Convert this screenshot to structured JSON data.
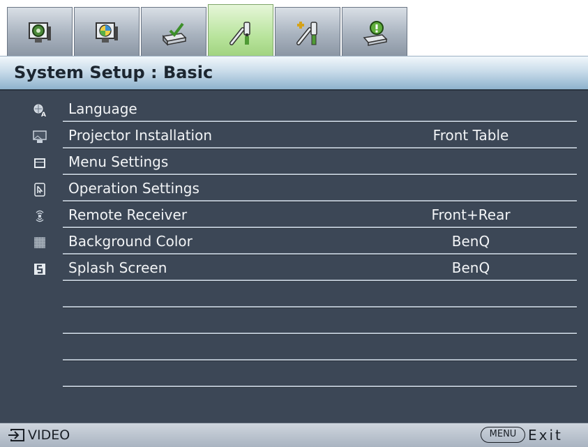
{
  "tabs": [
    {
      "name": "picture",
      "icon": "monitor-gear-icon"
    },
    {
      "name": "picture-advanced",
      "icon": "monitor-palette-icon"
    },
    {
      "name": "display",
      "icon": "projector-check-icon"
    },
    {
      "name": "system-setup-basic",
      "icon": "tools-icon",
      "active": true
    },
    {
      "name": "system-setup-advanced",
      "icon": "tools-plus-icon"
    },
    {
      "name": "information",
      "icon": "projector-info-icon"
    }
  ],
  "title": "System Setup : Basic",
  "menu": {
    "items": [
      {
        "label": "Language",
        "value": "",
        "icon": "globe-language-icon"
      },
      {
        "label": "Projector Installation",
        "value": "Front Table",
        "icon": "projector-installation-icon"
      },
      {
        "label": "Menu Settings",
        "value": "",
        "icon": "menu-settings-icon"
      },
      {
        "label": "Operation Settings",
        "value": "",
        "icon": "operation-settings-icon"
      },
      {
        "label": "Remote Receiver",
        "value": "Front+Rear",
        "icon": "remote-receiver-icon"
      },
      {
        "label": "Background Color",
        "value": "BenQ",
        "icon": "background-color-icon"
      },
      {
        "label": "Splash Screen",
        "value": "BenQ",
        "icon": "splash-screen-icon"
      },
      {
        "label": "",
        "value": ""
      },
      {
        "label": "",
        "value": ""
      },
      {
        "label": "",
        "value": ""
      },
      {
        "label": "",
        "value": ""
      }
    ]
  },
  "footer": {
    "source": "VIDEO",
    "menu_key": "MENU",
    "exit": "Exit"
  },
  "colors": {
    "panel_bg": "#3c4756",
    "active_tab": "#b9e49d",
    "title_bar": "#c9dcea",
    "text": "#f2f4f6"
  }
}
